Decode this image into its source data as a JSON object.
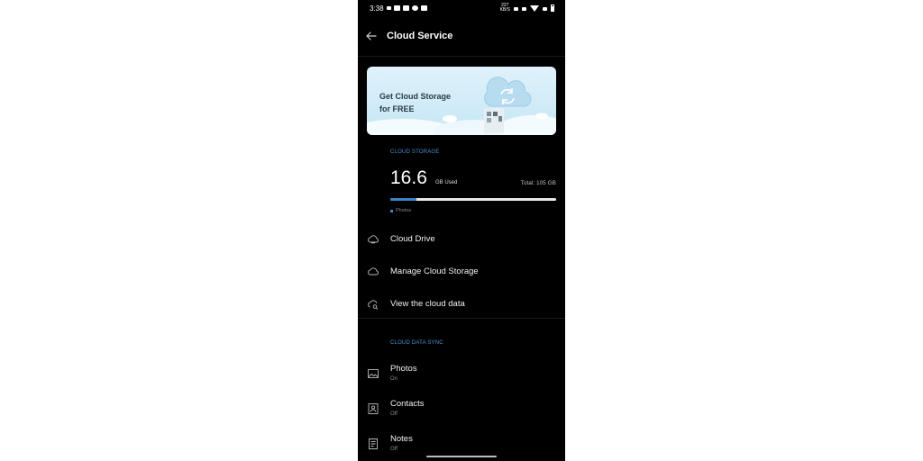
{
  "status_bar": {
    "time": "3:38",
    "speed_value": "227",
    "speed_unit": "KB/S"
  },
  "header": {
    "title": "Cloud Service",
    "back_icon": "arrow-left-icon"
  },
  "banner": {
    "title_line1": "Get Cloud Storage",
    "title_line2": "for FREE"
  },
  "cloud_storage": {
    "section_label": "CLOUD STORAGE",
    "used_value": "16.6",
    "used_unit": "GB Used",
    "total": "Total: 105 GB",
    "used_fraction": 0.158,
    "legend_label": "Photos",
    "accent_color": "#3d82c4"
  },
  "storage_menu": [
    {
      "label": "Cloud Drive",
      "icon": "cloud-drive-icon"
    },
    {
      "label": "Manage Cloud Storage",
      "icon": "cloud-icon"
    },
    {
      "label": "View the cloud data",
      "icon": "cloud-search-icon"
    }
  ],
  "cloud_data_sync": {
    "section_label": "CLOUD DATA SYNC",
    "items": [
      {
        "label": "Photos",
        "status": "On",
        "icon": "image-icon"
      },
      {
        "label": "Contacts",
        "status": "Off",
        "icon": "contact-icon"
      },
      {
        "label": "Notes",
        "status": "Off",
        "icon": "note-icon"
      }
    ]
  }
}
